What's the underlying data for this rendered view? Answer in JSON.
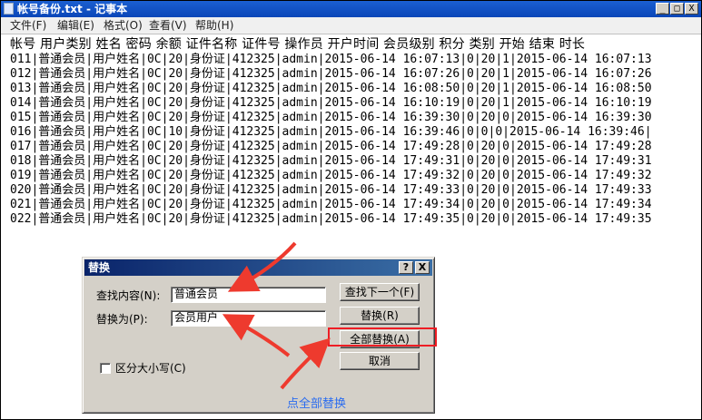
{
  "window": {
    "title": "帐号备份.txt - 记事本",
    "minimize_glyph": "_",
    "maximize_glyph": "□",
    "close_glyph": "X"
  },
  "menu": [
    {
      "label": "文件(F)"
    },
    {
      "label": "编辑(E)"
    },
    {
      "label": "格式(O)"
    },
    {
      "label": "查看(V)"
    },
    {
      "label": "帮助(H)"
    }
  ],
  "document": {
    "header": "帐号 用户类别 姓名 密码 余额 证件名称 证件号 操作员 开户时间 会员级别 积分 类别 开始 结束 时长",
    "lines": [
      "011|普通会员|用户姓名|0C|20|身份证|412325|admin|2015-06-14 16:07:13|0|20|1|2015-06-14 16:07:13",
      "012|普通会员|用户姓名|0C|20|身份证|412325|admin|2015-06-14 16:07:26|0|20|1|2015-06-14 16:07:26",
      "013|普通会员|用户姓名|0C|20|身份证|412325|admin|2015-06-14 16:08:50|0|20|1|2015-06-14 16:08:50",
      "014|普通会员|用户姓名|0C|20|身份证|412325|admin|2015-06-14 16:10:19|0|20|1|2015-06-14 16:10:19",
      "015|普通会员|用户姓名|0C|20|身份证|412325|admin|2015-06-14 16:39:30|0|20|0|2015-06-14 16:39:30",
      "016|普通会员|用户姓名|0C|10|身份证|412325|admin|2015-06-14 16:39:46|0|0|0|2015-06-14 16:39:46|",
      "017|普通会员|用户姓名|0C|20|身份证|412325|admin|2015-06-14 17:49:28|0|20|0|2015-06-14 17:49:28",
      "018|普通会员|用户姓名|0C|20|身份证|412325|admin|2015-06-14 17:49:31|0|20|0|2015-06-14 17:49:31",
      "019|普通会员|用户姓名|0C|20|身份证|412325|admin|2015-06-14 17:49:32|0|20|0|2015-06-14 17:49:32",
      "020|普通会员|用户姓名|0C|20|身份证|412325|admin|2015-06-14 17:49:33|0|20|0|2015-06-14 17:49:33",
      "021|普通会员|用户姓名|0C|20|身份证|412325|admin|2015-06-14 17:49:34|0|20|0|2015-06-14 17:49:34",
      "022|普通会员|用户姓名|0C|20|身份证|412325|admin|2015-06-14 17:49:35|0|20|0|2015-06-14 17:49:35"
    ]
  },
  "dialog": {
    "title": "替换",
    "help_glyph": "?",
    "close_glyph": "X",
    "find_label": "查找内容(N):",
    "find_value": "普通会员",
    "replace_label": "替换为(P):",
    "replace_value": "会员用户",
    "find_next_button": "查找下一个(F)",
    "replace_button": "替换(R)",
    "replace_all_button": "全部替换(A)",
    "cancel_button": "取消",
    "match_case_label": "区分大小写(C)"
  },
  "annotation": {
    "text": "点全部替换",
    "highlight_color": "#ee1d24",
    "text_color": "#2a6cf0"
  }
}
